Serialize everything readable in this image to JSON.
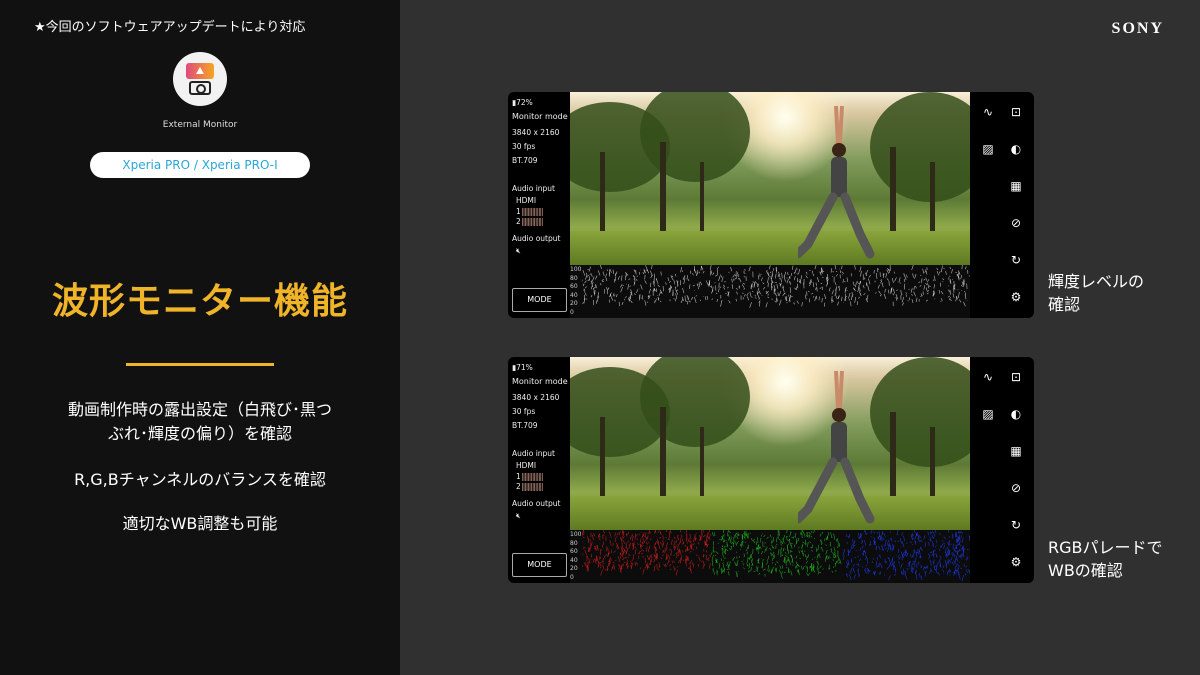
{
  "header": {
    "notice": "★今回のソフトウェアアップデートにより対応",
    "brand": "SONY"
  },
  "app": {
    "icon": "external-monitor-app-icon",
    "label": "External Monitor",
    "devices": "Xperia PRO / Xperia PRO-I"
  },
  "feature": {
    "title": "波形モニター機能",
    "accent_color": "#f0b429",
    "desc_line1": "動画制作時の露出設定（白飛び･黒つ",
    "desc_line2": "ぶれ･輝度の偏り）を確認",
    "desc_rgb": "R,G,Bチャンネルのバランスを確認",
    "desc_wb": "適切なWB調整も可能"
  },
  "monitors": [
    {
      "battery": "72%",
      "mode": "Monitor mode",
      "resolution": "3840 x 2160",
      "fps": "30 fps",
      "color": "BT.709",
      "audio_input": "Audio input",
      "source": "HDMI",
      "ch1": "1",
      "ch2": "2",
      "audio_output": "Audio output",
      "mode_button": "MODE",
      "scope_type": "luminance",
      "scale": [
        "100",
        "80",
        "60",
        "40",
        "20",
        "0"
      ],
      "caption_line1": "輝度レベルの",
      "caption_line2": "確認"
    },
    {
      "battery": "71%",
      "mode": "Monitor mode",
      "resolution": "3840 x 2160",
      "fps": "30 fps",
      "color": "BT.709",
      "audio_input": "Audio input",
      "source": "HDMI",
      "ch1": "1",
      "ch2": "2",
      "audio_output": "Audio output",
      "mode_button": "MODE",
      "scope_type": "rgb-parade",
      "scale": [
        "100",
        "80",
        "60",
        "40",
        "20",
        "0"
      ],
      "caption_line1": "RGBパレードで",
      "caption_line2": "WBの確認"
    }
  ],
  "colors": {
    "parade_red": "#e02020",
    "parade_green": "#22c422",
    "parade_blue": "#2040ff",
    "pill_text": "#2aa6d8"
  }
}
